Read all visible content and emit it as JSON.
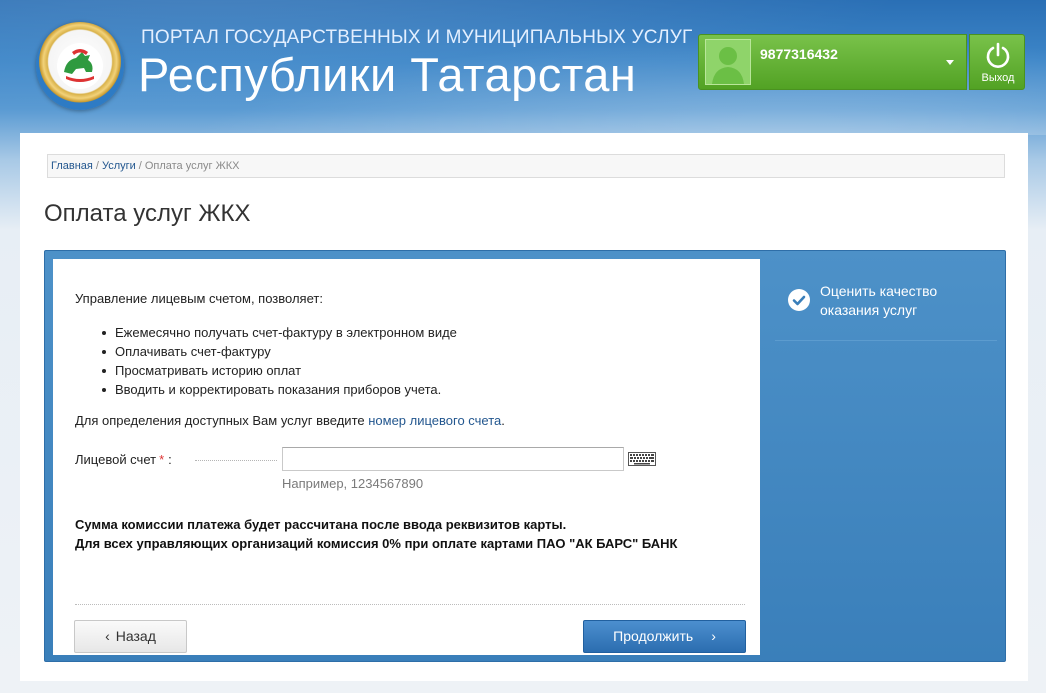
{
  "header": {
    "portal_line1": "ПОРТАЛ ГОСУДАРСТВЕННЫХ И МУНИЦИПАЛЬНЫХ УСЛУГ",
    "portal_line2": "Республики Татарстан",
    "emblem_icon": "tatarstan-emblem-icon"
  },
  "user": {
    "phone": "9877316432",
    "avatar_icon": "user-avatar-icon",
    "menu_icon": "caret-down-icon",
    "logout_label": "Выход",
    "logout_icon": "power-icon"
  },
  "breadcrumb": {
    "items": [
      "Главная",
      "Услуги",
      "Оплата услуг ЖКХ"
    ],
    "separator": "/"
  },
  "page_title": "Оплата услуг ЖКХ",
  "content": {
    "intro": "Управление лицевым счетом, позволяет:",
    "features": [
      "Ежемесячно получать счет-фактуру в электронном виде",
      "Оплачивать счет-фактуру",
      "Просматривать историю оплат",
      "Вводить и корректировать показания приборов учета."
    ],
    "hint_text": "Для определения доступных Вам услуг введите ",
    "hint_link": "номер лицевого счета",
    "hint_end": ".",
    "account_label": "Лицевой счет",
    "required_mark": "*",
    "colon": ":",
    "account_value": "",
    "account_example": "Например, 1234567890",
    "keyboard_icon": "virtual-keyboard-icon",
    "commission_line1": "Сумма комиссии платежа будет рассчитана после ввода реквизитов карты.",
    "commission_line2": "Для всех управляющих организаций комиссия 0% при оплате картами ПАО \"АК БАРС\" БАНК"
  },
  "buttons": {
    "back_label": "Назад",
    "next_label": "Продолжить",
    "back_chevron": "‹",
    "next_chevron": "›"
  },
  "sidebar": {
    "rate_label": "Оценить качество оказания услуг",
    "rate_icon": "check-circle-icon"
  },
  "colors": {
    "header_blue": "#2a6fb5",
    "user_green": "#52a224",
    "link_blue": "#23578f",
    "panel_blue": "#3a7fba",
    "required_red": "#d33"
  }
}
